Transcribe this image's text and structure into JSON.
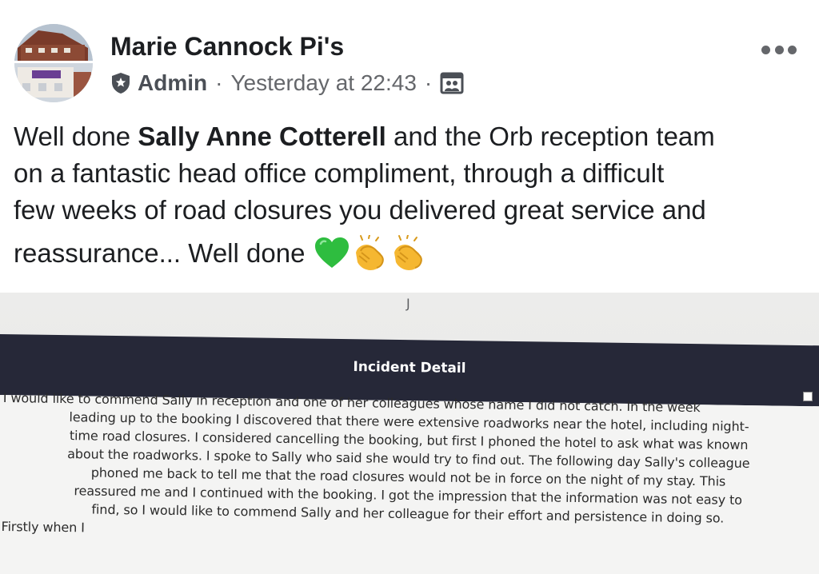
{
  "post": {
    "author": "Marie Cannock Pi's",
    "role": "Admin",
    "separator": "·",
    "timestamp": "Yesterday at 22:43",
    "privacy_icon": "group-icon",
    "more_icon": "more-dots-icon",
    "text": {
      "line1_pre": "Well done ",
      "line1_bold": "Sally Anne Cotterell",
      "line1_post": " and the Orb reception team",
      "line2": "on a fantastic head office compliment, through a difficult",
      "line3": "few weeks of road closures you delivered great service and",
      "line4": "reassurance... Well done"
    },
    "emojis": [
      "green-heart-icon",
      "clapping-hands-icon",
      "clapping-hands-icon"
    ]
  },
  "photo": {
    "top_mark": "J",
    "section_title": "Incident Detail",
    "lines": [
      "I would like to commend Sally in reception and one of her colleagues whose name I did not catch. In the week",
      "leading up to the booking I discovered that there were extensive roadworks near the hotel, including night-",
      "time road closures.  I considered cancelling the booking, but first I phoned the hotel to ask what was known",
      "about the roadworks.  I spoke to Sally who said she would try to find out.   The following day Sally's colleague",
      "phoned me back to tell me that the road closures would not be in force on the night of my stay.  This",
      "reassured me and I continued with the booking.  I got the impression that the information was not easy to",
      "find, so I would like to commend Sally and her colleague for their effort and persistence in doing so.",
      "Firstly when I"
    ]
  },
  "colors": {
    "text": "#1c1e21",
    "meta": "#65676b",
    "doc_header": "#262838",
    "heart": "#2ebd3f",
    "clap": "#f5b731"
  }
}
